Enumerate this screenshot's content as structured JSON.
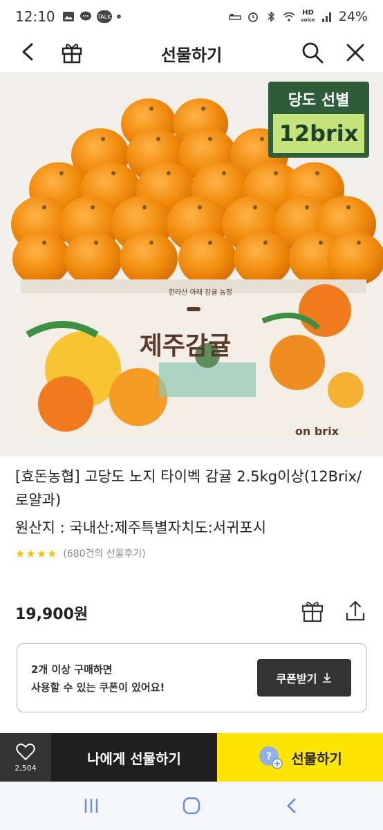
{
  "status_bar": {
    "time": "12:10",
    "talk_badge": "TALK",
    "network": "HD",
    "network_sub": "voice",
    "battery": "24%"
  },
  "header": {
    "title": "선물하기"
  },
  "badge": {
    "label": "당도 선별",
    "value": "12brix"
  },
  "product": {
    "title": "[효돈농협] 고당도 노지 타이벡 감귤 2.5kg이상(12Brix/로얄과)",
    "origin": "원산지 : 국내산:제주특별자치도:서귀포시",
    "stars": "★★★★",
    "rating": 4,
    "review_count": "(680건의 선물후기)",
    "price": "19,900원"
  },
  "coupon": {
    "line1": "2개 이상 구매하면",
    "line2": "사용할 수 있는 쿠폰이 있어요!",
    "button": "쿠폰받기"
  },
  "action_bar": {
    "like_count": "2,504",
    "gift_self": "나에게 선물하기",
    "gift_send": "선물하기"
  },
  "colors": {
    "accent": "#fee500",
    "dark": "#1f1f1f",
    "badge_green": "#2e5d3a",
    "badge_lime": "#c5e37a"
  }
}
